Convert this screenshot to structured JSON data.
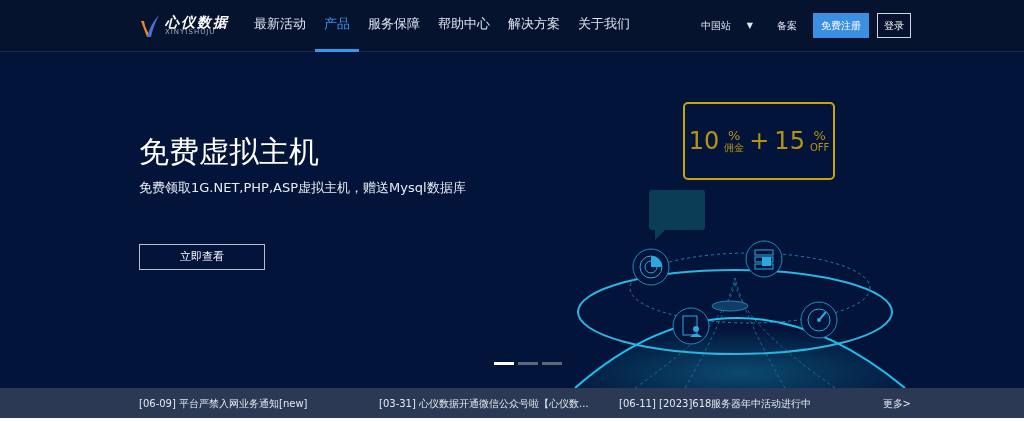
{
  "header": {
    "logo": {
      "name": "心仪数据",
      "pinyin": "XINYISHUJU"
    },
    "nav": [
      {
        "label": "最新活动",
        "selected": false
      },
      {
        "label": "产品",
        "selected": true
      },
      {
        "label": "服务保障",
        "selected": false
      },
      {
        "label": "帮助中心",
        "selected": false
      },
      {
        "label": "解决方案",
        "selected": false
      },
      {
        "label": "关于我们",
        "selected": false
      }
    ],
    "region": {
      "label": "中国站",
      "caret": "▼"
    },
    "record_link": "备案",
    "register_button": "免费注册",
    "login_button": "登录"
  },
  "hero": {
    "title": "免费虚拟主机",
    "subtitle": "免费领取1G.NET,PHP,ASP虚拟主机，赠送Mysql数据库",
    "button": "立即查看",
    "promo": {
      "first": "10",
      "first_unit": "%",
      "first_note": "佣金",
      "plus": "+",
      "second": "15",
      "second_unit": "%",
      "second_note": "OFF"
    },
    "slides": [
      {
        "selected": true
      },
      {
        "selected": false
      },
      {
        "selected": false
      }
    ]
  },
  "news": {
    "items": [
      "[06-09] 平台严禁入网业务通知[new]",
      "[03-31] 心仪数据开通微信公众号啦【心仪数...",
      "[06-11] [2023]618服务器年中活动进行中"
    ],
    "more": "更多>"
  }
}
